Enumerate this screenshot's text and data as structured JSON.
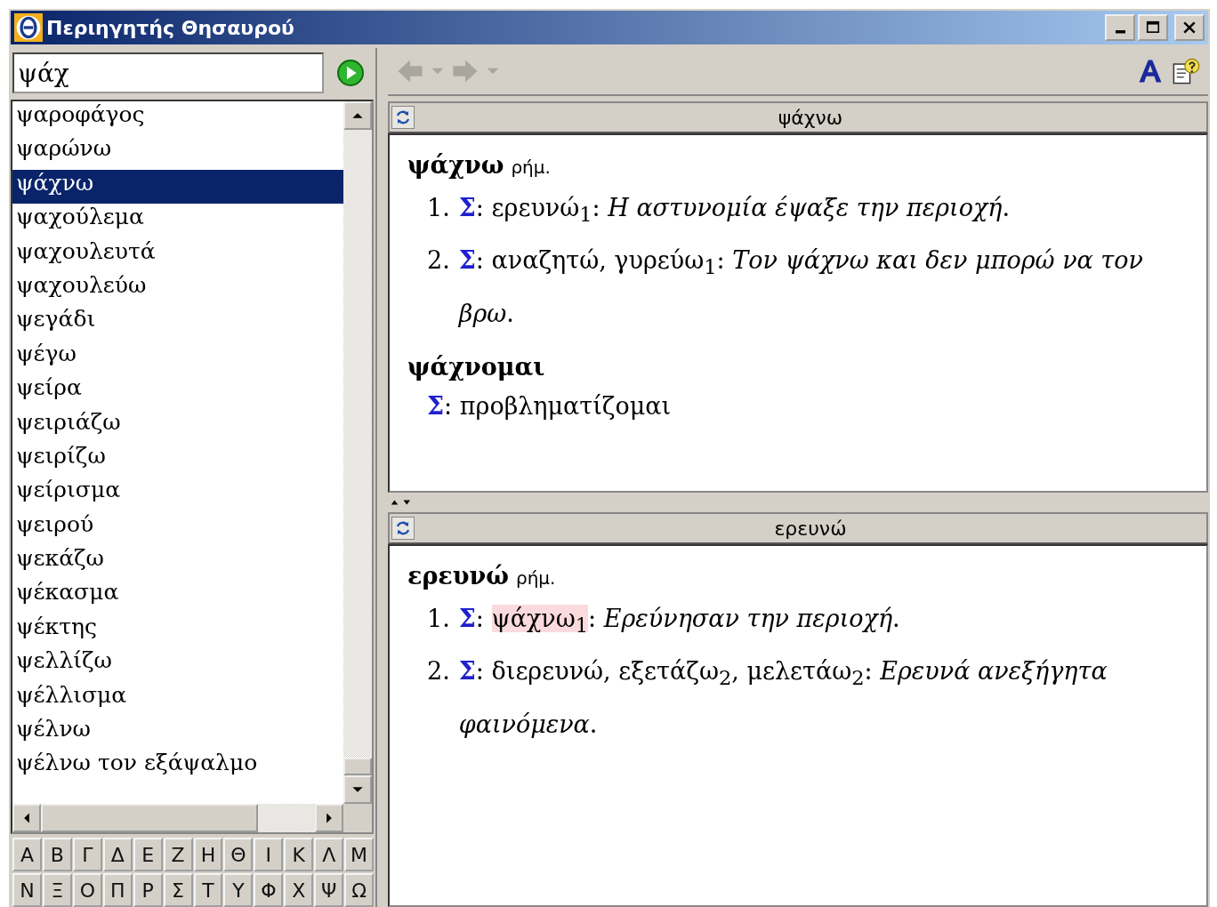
{
  "window": {
    "title": "Περιηγητής Θησαυρού"
  },
  "search": {
    "value": "ψάχ"
  },
  "word_list": [
    {
      "label": "ψαροφάγος",
      "selected": false
    },
    {
      "label": "ψαρώνω",
      "selected": false
    },
    {
      "label": "ψάχνω",
      "selected": true
    },
    {
      "label": "ψαχούλεμα",
      "selected": false
    },
    {
      "label": "ψαχουλευτά",
      "selected": false
    },
    {
      "label": "ψαχουλεύω",
      "selected": false
    },
    {
      "label": "ψεγάδι",
      "selected": false
    },
    {
      "label": "ψέγω",
      "selected": false
    },
    {
      "label": "ψείρα",
      "selected": false
    },
    {
      "label": "ψειριάζω",
      "selected": false
    },
    {
      "label": "ψειρίζω",
      "selected": false
    },
    {
      "label": "ψείρισμα",
      "selected": false
    },
    {
      "label": "ψειρού",
      "selected": false
    },
    {
      "label": "ψεκάζω",
      "selected": false
    },
    {
      "label": "ψέκασμα",
      "selected": false
    },
    {
      "label": "ψέκτης",
      "selected": false
    },
    {
      "label": "ψελλίζω",
      "selected": false
    },
    {
      "label": "ψέλλισμα",
      "selected": false
    },
    {
      "label": "ψέλνω",
      "selected": false
    },
    {
      "label": "ψέλνω τον εξάψαλμο",
      "selected": false
    }
  ],
  "alphabet": [
    [
      "Α",
      "Β",
      "Γ",
      "Δ",
      "Ε",
      "Ζ",
      "Η",
      "Θ",
      "Ι",
      "Κ",
      "Λ",
      "Μ"
    ],
    [
      "Ν",
      "Ξ",
      "Ο",
      "Π",
      "Ρ",
      "Σ",
      "Τ",
      "Υ",
      "Φ",
      "Χ",
      "Ψ",
      "Ω"
    ]
  ],
  "panes": [
    {
      "title": "ψάχνω",
      "entries": [
        {
          "headword": "ψάχνω",
          "pos": "ρήμ.",
          "senses": [
            {
              "number": "1.",
              "tag": "Σ",
              "parts": [
                {
                  "text": ": ερευνώ$_{1}$: *Η αστυνομία έψαξε την περιοχή*.",
                  "highlighted": false
                }
              ]
            },
            {
              "number": "2.",
              "tag": "Σ",
              "parts": [
                {
                  "text": ": αναζητώ, γυρεύω$_{1}$: *Τον ψάχνω και δεν μπορώ να τον βρω*.",
                  "highlighted": false
                }
              ]
            }
          ]
        },
        {
          "headword": "ψάχνομαι",
          "senses": [
            {
              "tag": "Σ",
              "parts": [
                {
                  "text": ": προβληματίζομαι",
                  "highlighted": false
                }
              ]
            }
          ]
        }
      ]
    },
    {
      "title": "ερευνώ",
      "entries": [
        {
          "headword": "ερευνώ",
          "pos": "ρήμ.",
          "senses": [
            {
              "number": "1.",
              "tag": "Σ",
              "parts": [
                {
                  "text": ": ",
                  "highlighted": false
                },
                {
                  "text": "ψάχνω$_{1}$",
                  "highlighted": true
                },
                {
                  "text": ": *Ερεύνησαν την περιοχή*.",
                  "highlighted": false
                }
              ]
            },
            {
              "number": "2.",
              "tag": "Σ",
              "parts": [
                {
                  "text": ": διερευνώ, εξετάζω$_{2}$, μελετάω$_{2}$: *Ερευνά ανεξήγητα φαινόμενα*.",
                  "highlighted": false
                }
              ]
            }
          ]
        }
      ]
    }
  ]
}
